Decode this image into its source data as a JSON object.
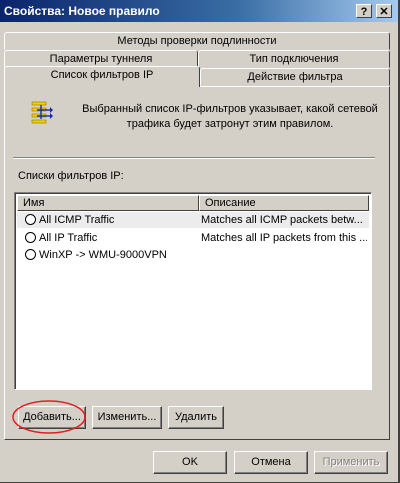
{
  "window": {
    "title": "Свойства: Новое правило",
    "help_glyph": "?",
    "close_glyph": "✕"
  },
  "tabs": {
    "row1": [
      "Методы проверки подлинности"
    ],
    "row2": [
      "Параметры туннеля",
      "Тип подключения"
    ],
    "row3": [
      "Список фильтров IP",
      "Действие фильтра"
    ]
  },
  "info": {
    "icon": "filter-list-icon",
    "text": "Выбранный список IP-фильтров указывает, какой сетевой трафика будет затронут этим правилом."
  },
  "filter_list": {
    "label": "Списки фильтров IP:",
    "columns": [
      "Имя",
      "Описание"
    ],
    "rows": [
      {
        "name": "All ICMP Traffic",
        "description": "Matches all ICMP packets betw...",
        "selected": true
      },
      {
        "name": "All IP Traffic",
        "description": "Matches all IP packets from this ...",
        "selected": false
      },
      {
        "name": "WinXP -> WMU-9000VPN",
        "description": "",
        "selected": false
      }
    ]
  },
  "buttons": {
    "add": "Добавить...",
    "edit": "Изменить...",
    "delete": "Удалить",
    "ok": "OK",
    "cancel": "Отмена",
    "apply": "Применить"
  },
  "annotation": {
    "color": "#e02020",
    "target": "add-button"
  }
}
